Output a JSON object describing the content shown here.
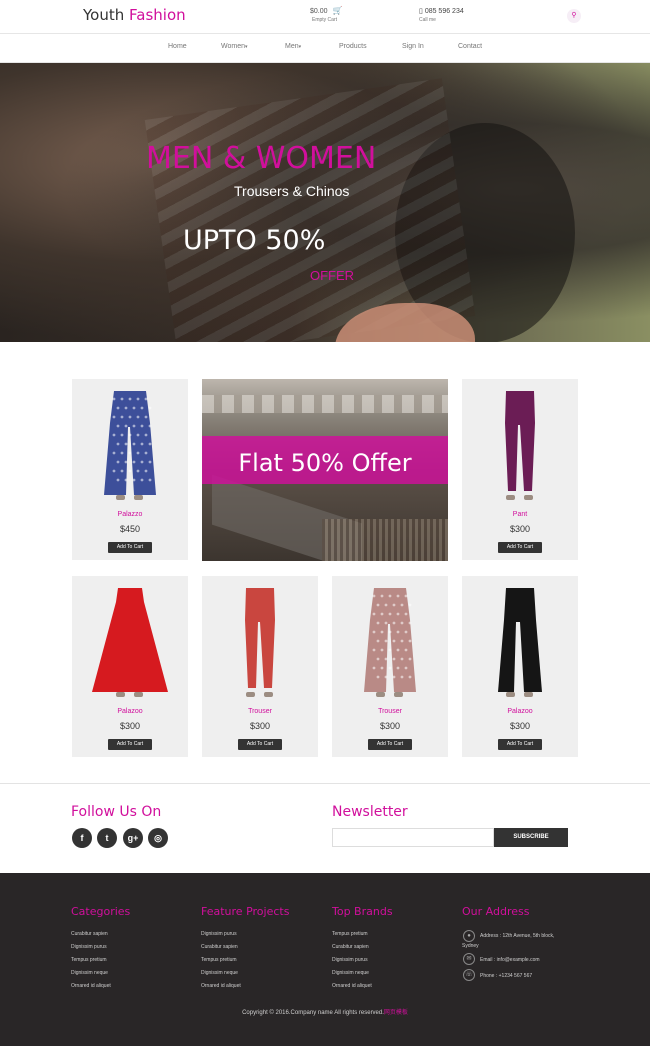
{
  "header": {
    "logo_part1": "Youth",
    "logo_part2": "Fashion",
    "cart_amount": "$0.00",
    "cart_empty": "Empty Cart",
    "phone_number": "085 596 234",
    "phone_label": "Call me"
  },
  "nav": {
    "items": [
      {
        "label": "Home"
      },
      {
        "label": "Women"
      },
      {
        "label": "Men"
      },
      {
        "label": "Products"
      },
      {
        "label": "Sign In"
      },
      {
        "label": "Contact"
      }
    ]
  },
  "hero": {
    "title": "MEN & WOMEN",
    "subtitle": "Trousers & Chinos",
    "discount": "UPTO 50%",
    "offer": "OFFER"
  },
  "promo": {
    "text": "Flat 50% Offer"
  },
  "products": [
    {
      "name": "Palazzo",
      "price": "$450",
      "button": "Add To Cart",
      "color": "#3d4f9a",
      "style": "print"
    },
    {
      "name": "Pant",
      "price": "$300",
      "button": "Add To Cart",
      "color": "#6b1d55",
      "style": "slim"
    },
    {
      "name": "Palazoo",
      "price": "$300",
      "button": "Add To Cart",
      "color": "#d61a1f",
      "style": "skirt"
    },
    {
      "name": "Trouser",
      "price": "$300",
      "button": "Add To Cart",
      "color": "#c9463f",
      "style": "slim"
    },
    {
      "name": "Trouser",
      "price": "$300",
      "button": "Add To Cart",
      "color": "#b98a86",
      "style": "print"
    },
    {
      "name": "Palazoo",
      "price": "$300",
      "button": "Add To Cart",
      "color": "#151515",
      "style": "wide"
    }
  ],
  "follow": {
    "title": "Follow Us On",
    "icons": [
      "facebook-icon",
      "twitter-icon",
      "google-plus-icon",
      "instagram-icon"
    ],
    "glyphs": [
      "f",
      "t",
      "g+",
      "◎"
    ]
  },
  "newsletter": {
    "title": "Newsletter",
    "placeholder": "",
    "button": "SUBSCRIBE"
  },
  "footer": {
    "categories": {
      "title": "Categories",
      "items": [
        "Curabitur sapien",
        "Dignissim purus",
        "Tempus pretium",
        "Dignissim neque",
        "Ornared id aliquet"
      ]
    },
    "feature_projects": {
      "title": "Feature Projects",
      "items": [
        "Dignissim purus",
        "Curabitur sapien",
        "Tempus pretium",
        "Dignissim neque",
        "Ornared id aliquet"
      ]
    },
    "top_brands": {
      "title": "Top Brands",
      "items": [
        "Tempus pretium",
        "Curabitur sapien",
        "Dignissim purus",
        "Dignissim neque",
        "Ornared id aliquet"
      ]
    },
    "address": {
      "title": "Our Address",
      "line1": "Address : 12th Avenue, 5th block,",
      "line2": "Sydney",
      "email": "Email : info@example.com",
      "phone": "Phone : +1234 567 567"
    },
    "copyright": "Copyright © 2016.Company name All rights reserved.",
    "copyright_link": "网页模板"
  },
  "colors": {
    "accent": "#d10f9c",
    "dark": "#292627"
  }
}
